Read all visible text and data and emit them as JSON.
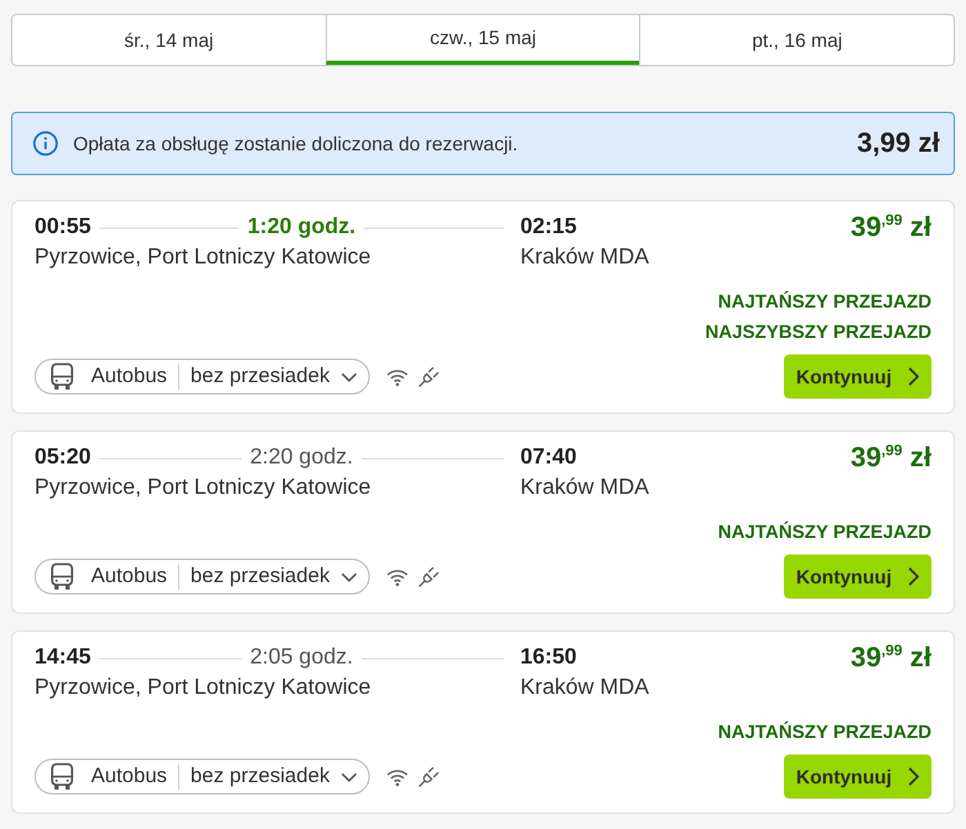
{
  "date_tabs": [
    {
      "label": "śr., 14 maj",
      "selected": false
    },
    {
      "label": "czw., 15 maj",
      "selected": true
    },
    {
      "label": "pt., 16 maj",
      "selected": false
    }
  ],
  "fee_notice": {
    "text": "Opłata za obsługę zostanie doliczona do rezerwacji.",
    "amount": "3,99 zł"
  },
  "trips": [
    {
      "departure_time": "00:55",
      "duration": {
        "text": "1:20 godz.",
        "highlighted": true
      },
      "arrival_time": "02:15",
      "departure_station": "Pyrzowice, Port Lotniczy Katowice",
      "arrival_station": "Kraków MDA",
      "price": "39$^{,99}$ zł",
      "labels": [
        "NAJTAŃSZY PRZEJAZD",
        "NAJSZYBSZY PRZEJAZD"
      ],
      "transport": "Autobus",
      "connection": "bez przesiadek",
      "button": "Kontynuuj"
    },
    {
      "departure_time": "05:20",
      "duration": {
        "text": "2:20 godz.",
        "highlighted": false
      },
      "arrival_time": "07:40",
      "departure_station": "Pyrzowice, Port Lotniczy Katowice",
      "arrival_station": "Kraków MDA",
      "price": "39$^{,99}$ zł",
      "labels": [
        "NAJTAŃSZY PRZEJAZD"
      ],
      "transport": "Autobus",
      "connection": "bez przesiadek",
      "button": "Kontynuuj"
    },
    {
      "departure_time": "14:45",
      "duration": {
        "text": "2:05 godz.",
        "highlighted": false
      },
      "arrival_time": "16:50",
      "departure_station": "Pyrzowice, Port Lotniczy Katowice",
      "arrival_station": "Kraków MDA",
      "price": "39$^{,99}$ zł",
      "labels": [
        "NAJTAŃSZY PRZEJAZD"
      ],
      "transport": "Autobus",
      "connection": "bez przesiadek",
      "button": "Kontynuuj"
    }
  ]
}
